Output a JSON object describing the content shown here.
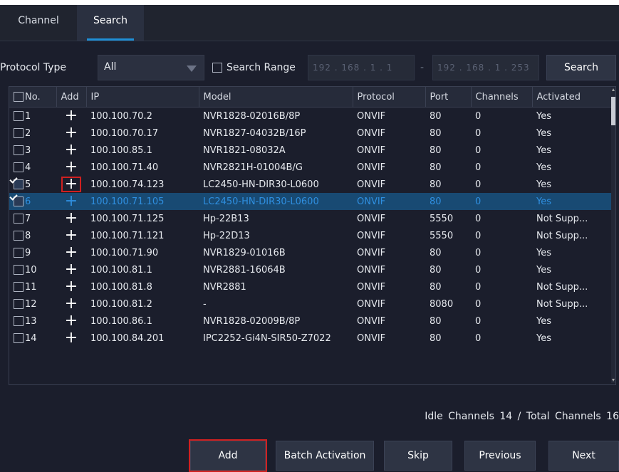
{
  "tabs": [
    {
      "label": "Channel"
    },
    {
      "label": "Search"
    }
  ],
  "search": {
    "protocol_label": "Protocol Type",
    "protocol_value": "All",
    "range_label": "Search Range",
    "range_start": "192 . 168 .  1 .  1",
    "range_sep": "-",
    "range_end": "192 . 168 .  1 . 253",
    "search_button": "Search"
  },
  "table": {
    "headers": [
      "No.",
      "Add",
      "IP",
      "Model",
      "Protocol",
      "Port",
      "Channels",
      "Activated"
    ],
    "rows": [
      {
        "no": "1",
        "ip": "100.100.70.2",
        "model": "NVR1828-02016B/8P",
        "protocol": "ONVIF",
        "port": "80",
        "channels": "0",
        "activated": "Yes",
        "checked": false
      },
      {
        "no": "2",
        "ip": "100.100.70.17",
        "model": "NVR1827-04032B/16P",
        "protocol": "ONVIF",
        "port": "80",
        "channels": "0",
        "activated": "Yes",
        "checked": false
      },
      {
        "no": "3",
        "ip": "100.100.85.1",
        "model": "NVR1821-08032A",
        "protocol": "ONVIF",
        "port": "80",
        "channels": "0",
        "activated": "Yes",
        "checked": false
      },
      {
        "no": "4",
        "ip": "100.100.71.40",
        "model": "NVR2821H-01004B/G",
        "protocol": "ONVIF",
        "port": "80",
        "channels": "0",
        "activated": "Yes",
        "checked": false
      },
      {
        "no": "5",
        "ip": "100.100.74.123",
        "model": "LC2450-HN-DIR30-L0600",
        "protocol": "ONVIF",
        "port": "80",
        "channels": "0",
        "activated": "Yes",
        "checked": true
      },
      {
        "no": "6",
        "ip": "100.100.71.105",
        "model": "LC2450-HN-DIR30-L0600",
        "protocol": "ONVIF",
        "port": "80",
        "channels": "0",
        "activated": "Yes",
        "checked": true
      },
      {
        "no": "7",
        "ip": "100.100.71.125",
        "model": "Hp-22B13",
        "protocol": "ONVIF",
        "port": "5550",
        "channels": "0",
        "activated": "Not Supp...",
        "checked": false
      },
      {
        "no": "8",
        "ip": "100.100.71.121",
        "model": "Hp-22D13",
        "protocol": "ONVIF",
        "port": "5550",
        "channels": "0",
        "activated": "Not Supp...",
        "checked": false
      },
      {
        "no": "9",
        "ip": "100.100.71.90",
        "model": "NVR1829-01016B",
        "protocol": "ONVIF",
        "port": "80",
        "channels": "0",
        "activated": "Yes",
        "checked": false
      },
      {
        "no": "10",
        "ip": "100.100.81.1",
        "model": "NVR2881-16064B",
        "protocol": "ONVIF",
        "port": "80",
        "channels": "0",
        "activated": "Yes",
        "checked": false
      },
      {
        "no": "11",
        "ip": "100.100.81.8",
        "model": "NVR2881",
        "protocol": "ONVIF",
        "port": "80",
        "channels": "0",
        "activated": "Not Supp...",
        "checked": false
      },
      {
        "no": "12",
        "ip": "100.100.81.2",
        "model": "-",
        "protocol": "ONVIF",
        "port": "8080",
        "channels": "0",
        "activated": "Not Supp...",
        "checked": false
      },
      {
        "no": "13",
        "ip": "100.100.86.1",
        "model": "NVR1828-02009B/8P",
        "protocol": "ONVIF",
        "port": "80",
        "channels": "0",
        "activated": "Yes",
        "checked": false
      },
      {
        "no": "14",
        "ip": "100.100.84.201",
        "model": "IPC2252-Gi4N-SIR50-Z7022",
        "protocol": "ONVIF",
        "port": "80",
        "channels": "0",
        "activated": "Yes",
        "checked": false
      }
    ],
    "add_symbol": "+"
  },
  "status": "Idle Channels 14 / Total Channels 16",
  "actions": {
    "add": "Add",
    "batch_activation": "Batch Activation",
    "skip": "Skip",
    "previous": "Previous",
    "next": "Next"
  },
  "colors": {
    "background": "#1b1e2c",
    "selected_row": "#184a73",
    "selected_text": "#2f8fe0",
    "highlight_box": "#d02020"
  }
}
